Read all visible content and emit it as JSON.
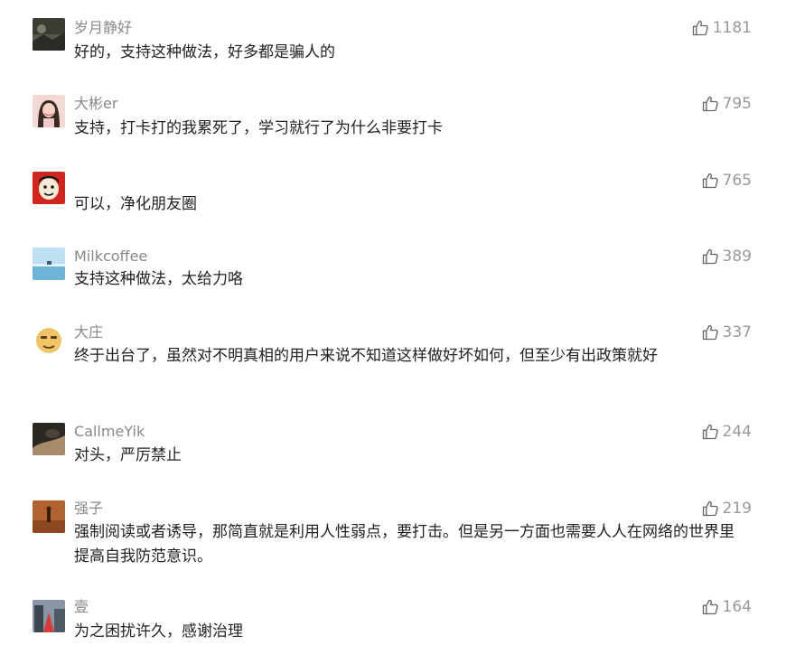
{
  "accent": "#576b95",
  "comments": [
    {
      "nickname": "岁月静好",
      "text": "好的，支持这种做法，好多都是骗人的",
      "likes": "1181",
      "avatar_icon": "dark-landscape-avatar"
    },
    {
      "nickname": "大彬er",
      "text": "支持，打卡打的我累死了，学习就行了为什么非要打卡",
      "likes": "795",
      "avatar_icon": "girl-portrait-avatar"
    },
    {
      "nickname": "",
      "text": "可以，净化朋友圈",
      "likes": "765",
      "avatar_icon": "red-cartoon-avatar"
    },
    {
      "nickname": "Milkcoffee",
      "text": "支持这种做法，太给力咯",
      "likes": "389",
      "avatar_icon": "sea-sky-avatar"
    },
    {
      "nickname": "大庄",
      "text": "终于出台了，虽然对不明真相的用户来说不知道这样做好坏如何，但至少有出政策就好",
      "likes": "337",
      "avatar_icon": "smiley-face-avatar"
    },
    {
      "nickname": "CallmeYik",
      "text": "对头，严厉禁止",
      "likes": "244",
      "avatar_icon": "dark-photo-avatar"
    },
    {
      "nickname": "强子",
      "text": "强制阅读或者诱导，那简直就是利用人性弱点，要打击。但是另一方面也需要人人在网络的世界里提高自我防范意识。",
      "likes": "219",
      "avatar_icon": "brown-figure-avatar"
    },
    {
      "nickname": "壹",
      "text": "为之困扰许久，感谢治理",
      "likes": "164",
      "avatar_icon": "city-street-avatar"
    }
  ]
}
